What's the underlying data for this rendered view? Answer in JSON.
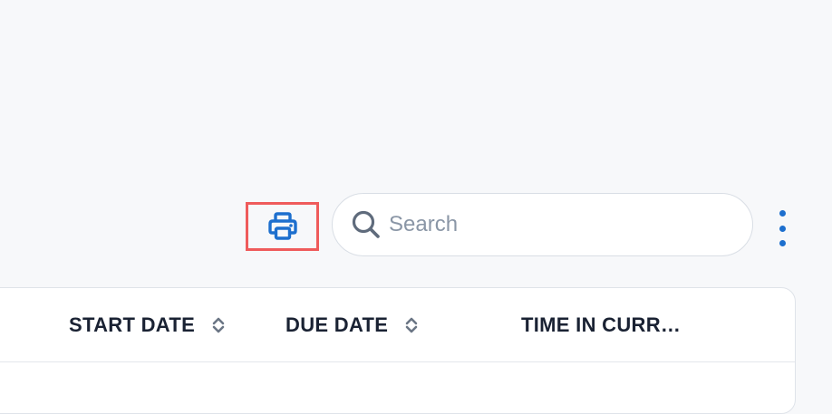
{
  "toolbar": {
    "print_icon": "printer-icon",
    "search": {
      "icon": "search-icon",
      "placeholder": "Search",
      "value": ""
    },
    "more_icon": "more-vertical-icon"
  },
  "table": {
    "columns": [
      {
        "label": "START DATE",
        "sortable": true
      },
      {
        "label": "DUE DATE",
        "sortable": true
      },
      {
        "label": "TIME IN CURR…",
        "sortable": false
      }
    ]
  },
  "colors": {
    "accent": "#1d6fce",
    "highlight": "#ef5b5b",
    "background": "#f7f8fa",
    "header_text": "#1a2233",
    "sort_icon": "#6b7685"
  }
}
